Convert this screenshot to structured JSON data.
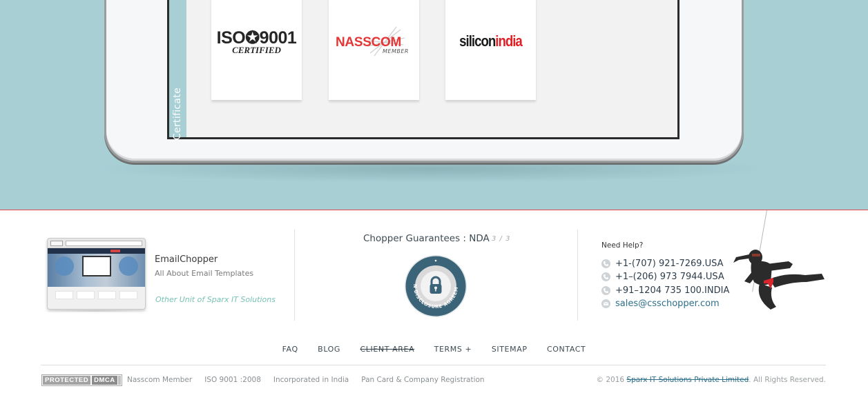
{
  "hero": {
    "section_label": "Certificate",
    "certificates": [
      {
        "name": "ISO 9001",
        "main": "ISO✪9001",
        "sub": "CERTIFIED"
      },
      {
        "name": "NASSCOM",
        "main": "NASSCOM",
        "sub": "MEMBER"
      },
      {
        "name": "siliconindia",
        "main_black": "silicon",
        "main_red": "india"
      }
    ],
    "colors": {
      "background": "#a7cfd4",
      "accent_line": "#e0474c"
    }
  },
  "footer": {
    "unit": {
      "name": "EmailChopper",
      "tagline": "All About Email Templates",
      "other_unit": "Other Unit of Sparx IT Solutions"
    },
    "guarantees": {
      "title": "Chopper Guarantees : NDA",
      "counter": "3 / 3",
      "badge_icon": "lock-icon",
      "badge_text": "NON DISCLOSURE AGREEMENT"
    },
    "help": {
      "title": "Need Help?",
      "contacts": [
        {
          "icon": "phone-icon",
          "text": "+1-(707) 921-7269.USA"
        },
        {
          "icon": "phone-icon",
          "text": "+1–(206) 973 7944.USA"
        },
        {
          "icon": "phone-icon",
          "text": "+91–1204 735 100.INDIA"
        },
        {
          "icon": "email-icon",
          "text": "sales@csschopper.com"
        }
      ]
    },
    "nav": [
      {
        "label": "FAQ"
      },
      {
        "label": "BLOG"
      },
      {
        "label": "CLIENT AREA"
      },
      {
        "label": "TERMS +"
      },
      {
        "label": "SITEMAP"
      },
      {
        "label": "CONTACT"
      }
    ],
    "dmca": {
      "left": "PROTECTED",
      "right": "DMCA"
    },
    "bottom_links": [
      {
        "label": "Nasscom Member"
      },
      {
        "label": "ISO 9001 :2008"
      },
      {
        "label": "Incorporated in India"
      },
      {
        "label": "Pan Card & Company Registration"
      }
    ],
    "copyright": {
      "prefix": "© 2016 ",
      "company": "Sparx IT Solutions Private Limited",
      "suffix": ". All Rights Reserved."
    }
  }
}
